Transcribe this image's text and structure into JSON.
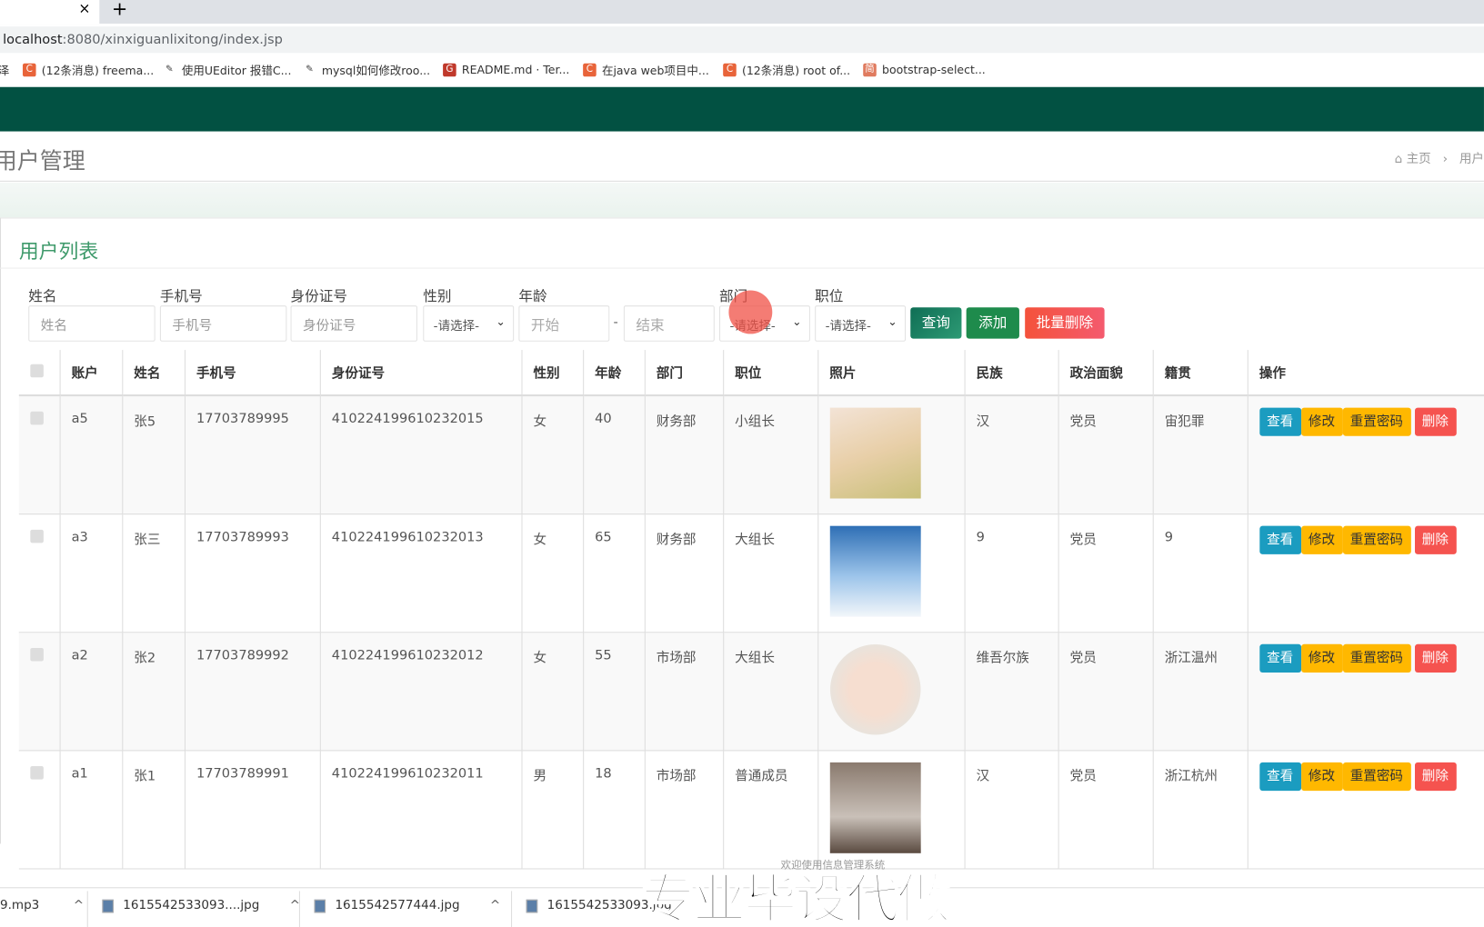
{
  "browser": {
    "tab_close": "×",
    "new_tab": "+",
    "url_host": "localhost",
    "url_path": ":8080/xinxiguanlixitong/index.jsp",
    "bookmarks": [
      {
        "label": "泽",
        "icon": ""
      },
      {
        "label": "(12条消息) freema...",
        "icon": "C"
      },
      {
        "label": "使用UEditor 报错C...",
        "icon": "✎"
      },
      {
        "label": "mysql如何修改roo...",
        "icon": "✎"
      },
      {
        "label": "README.md · Ter...",
        "icon": "G"
      },
      {
        "label": "在java web项目中...",
        "icon": "C"
      },
      {
        "label": "(12条消息) root of...",
        "icon": "C"
      },
      {
        "label": "bootstrap-select...",
        "icon": "简"
      }
    ]
  },
  "page": {
    "title": "用户管理",
    "breadcrumb": {
      "home": "主页",
      "sep": "›",
      "current": "用户"
    }
  },
  "box": {
    "title": "用户列表"
  },
  "filters": {
    "labels": [
      "姓名",
      "手机号",
      "身份证号",
      "性别",
      "年龄",
      "部门",
      "职位"
    ],
    "name_placeholder": "姓名",
    "phone_placeholder": "手机号",
    "id_placeholder": "身份证号",
    "gender_value": "-请选择-",
    "age_start": "开始",
    "age_sep": "-",
    "age_end": "结束",
    "dept_value": "-请选择-",
    "position_value": "-请选择-",
    "search": "查询",
    "add": "添加",
    "batch_delete": "批量删除"
  },
  "colors": {
    "nav": "#025142",
    "search": "#1a7a5e",
    "add": "#1e8b4c",
    "batch_delete": "#f4523b",
    "view": "#1b9cc0",
    "edit": "#ffb800",
    "delete": "#f5534f"
  },
  "table": {
    "headers": [
      "账户",
      "姓名",
      "手机号",
      "身份证号",
      "性别",
      "年龄",
      "部门",
      "职位",
      "照片",
      "民族",
      "政治面貌",
      "籍贯",
      "操作"
    ],
    "rows": [
      [
        "a5",
        "张5",
        "17703789995",
        "410224199610232015",
        "女",
        "40",
        "财务部",
        "小组长",
        "",
        "汉",
        "党员",
        "宙犯罪"
      ],
      [
        "a3",
        "张三",
        "17703789993",
        "410224199610232013",
        "女",
        "65",
        "财务部",
        "大组长",
        "",
        "9",
        "党员",
        "9"
      ],
      [
        "a2",
        "张2",
        "17703789992",
        "410224199610232012",
        "女",
        "55",
        "市场部",
        "大组长",
        "",
        "维吾尔族",
        "党员",
        "浙江温州"
      ],
      [
        "a1",
        "张1",
        "17703789991",
        "410224199610232011",
        "男",
        "18",
        "市场部",
        "普通成员",
        "",
        "汉",
        "党员",
        "浙江杭州"
      ]
    ],
    "actions": {
      "view": "查看",
      "edit": "修改",
      "reset": "重置密码",
      "delete": "删除"
    }
  },
  "footer": "欢迎使用信息管理系统",
  "downloads": [
    "9.mp3",
    "1615542533093....jpg",
    "1615542577444.jpg",
    "1615542533093.jpg"
  ],
  "watermark": "专业毕设代做"
}
